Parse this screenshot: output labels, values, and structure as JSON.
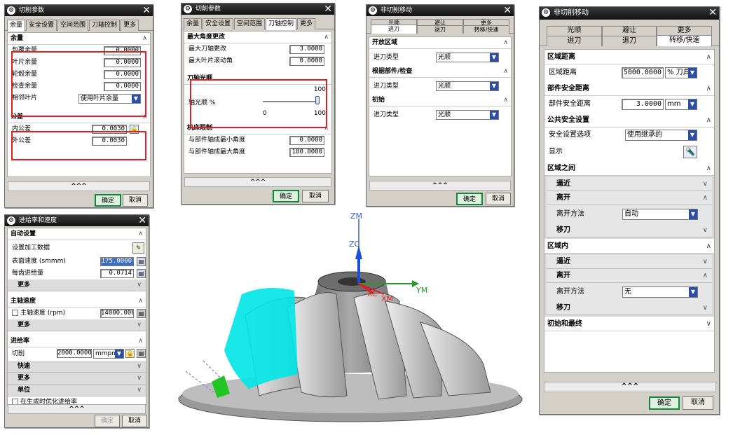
{
  "d1": {
    "title": "切削参数",
    "tabs": [
      "余量",
      "安全设置",
      "空间范围",
      "刀轴控制",
      "更多"
    ],
    "sec_stock": "余量",
    "rows": [
      {
        "label": "包覆余量",
        "value": "0.0000"
      },
      {
        "label": "叶片余量",
        "value": "0.0000"
      },
      {
        "label": "轮毂余量",
        "value": "0.0000"
      },
      {
        "label": "检查余量",
        "value": "0.0000"
      }
    ],
    "adj_label": "相邻叶片",
    "adj_value": "使用叶片余量",
    "sec_tol": "公差",
    "tol": [
      {
        "label": "内公差",
        "value": "0.0030"
      },
      {
        "label": "外公差",
        "value": "0.0030"
      }
    ],
    "expand": "^^^",
    "ok": "确定",
    "cancel": "取消"
  },
  "d2": {
    "title": "切削参数",
    "tabs": [
      "余量",
      "安全设置",
      "空间范围",
      "刀轴控制",
      "更多"
    ],
    "sec_angle": "最大角度更改",
    "rows": [
      {
        "label": "最大刀轴更改",
        "value": "3.0000"
      },
      {
        "label": "最大叶片滚动角",
        "value": "0.0000"
      }
    ],
    "sec_smooth": "刀轴光顺",
    "smooth_max": "100",
    "smooth_label": "轴光顺 %",
    "smooth_min": "0",
    "smooth_val": "100",
    "sec_limit": "机床限制",
    "limits": [
      {
        "label": "与部件轴成最小角度",
        "value": "0.0000"
      },
      {
        "label": "与部件轴成最大角度",
        "value": "180.0000"
      }
    ],
    "expand": "^^^",
    "ok": "确定",
    "cancel": "取消"
  },
  "d3": {
    "title": "非切削移动",
    "tabs_top": [
      "光顺",
      "避让",
      "更多"
    ],
    "tabs_bot": [
      "进刀",
      "退刀",
      "转移/快速"
    ],
    "secs": [
      {
        "title": "开放区域",
        "label": "进刀类型",
        "value": "光顺"
      },
      {
        "title": "根据部件/检查",
        "label": "进刀类型",
        "value": "光顺"
      },
      {
        "title": "初始",
        "label": "进刀类型",
        "value": "光顺"
      }
    ],
    "expand": "^^^",
    "ok": "确定",
    "cancel": "取消"
  },
  "d4": {
    "title": "非切削移动",
    "tabs_top": [
      "光顺",
      "避让",
      "更多"
    ],
    "tabs_bot": [
      "进刀",
      "退刀",
      "转移/快速"
    ],
    "sec_zone": "区域距离",
    "zone_label": "区域距离",
    "zone_value": "5000.0000",
    "zone_unit": "% 刀具",
    "sec_part": "部件安全距离",
    "part_label": "部件安全距离",
    "part_value": "3.0000",
    "part_unit": "mm",
    "sec_common": "公共安全设置",
    "opt_label": "安全设置选项",
    "opt_value": "使用继承的",
    "display": "显示",
    "sec_between": "区域之间",
    "approach": "逼近",
    "depart": "离开",
    "depart_method": "离开方法",
    "depart_value1": "自动",
    "transfer": "移刀",
    "sec_within": "区域内",
    "depart_value2": "无",
    "sec_init": "初始和最终",
    "expand": "^^^",
    "ok": "确定",
    "cancel": "取消"
  },
  "d5": {
    "title": "进给率和速度",
    "sec_auto": "自动设置",
    "set_data": "设置加工数据",
    "surf_speed": "表面速度 (smmm)",
    "surf_value": "175.0000",
    "feed_tooth": "每齿进给量",
    "feed_value": "0.0714",
    "more": "更多",
    "sec_spindle": "主轴速度",
    "spindle_label": "主轴速度 (rpm)",
    "spindle_value": "14000.000",
    "sec_feed": "进给率",
    "cut_label": "切削",
    "cut_value": "2000.0000",
    "cut_unit": "mmpm",
    "fast": "快速",
    "units": "单位",
    "optimize": "在生成时优化进给率",
    "expand": "^^^",
    "ok": "确定",
    "cancel": "取消"
  },
  "axes": {
    "zm": "ZM",
    "zc": "ZC",
    "ym": "YM",
    "xc": "XC",
    "xm": "XM"
  },
  "colors": {
    "highlight": "#e02020",
    "toolpath": "#00e5e5",
    "confirm": "#0a8a3a"
  }
}
